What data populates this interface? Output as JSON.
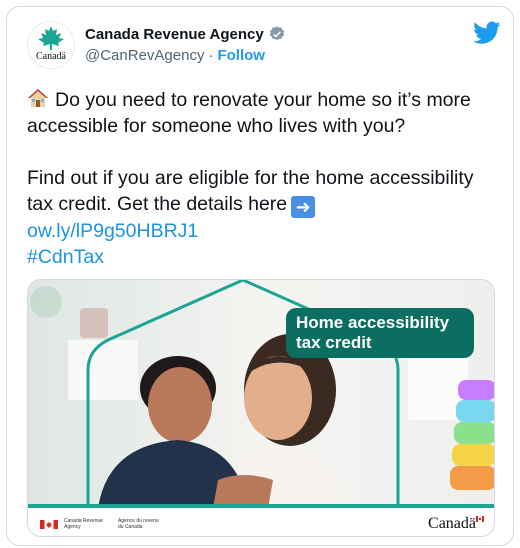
{
  "tweet": {
    "account": {
      "display_name": "Canada Revenue Agency",
      "handle": "@CanRevAgency",
      "separator": "·",
      "follow_label": "Follow",
      "avatar_wordmark": "Canadä",
      "verified": true
    },
    "text": {
      "line1": "Do you need to renovate your home so it’s more accessible for someone who lives with you?",
      "line2": "Find out if you are eligible for the home accessibility tax credit. Get the details here",
      "link": "ow.ly/lP9g50HBRJ1",
      "hashtag": "#CdnTax"
    },
    "icons": {
      "house": "house-emoji-icon",
      "arrow": "right-arrow-emoji-icon",
      "platform": "twitter-bird-icon",
      "verified": "verified-badge-icon"
    },
    "media": {
      "badge_line1": "Home accessibility",
      "badge_line2": "tax credit",
      "gov_en_line1": "Canada Revenue",
      "gov_en_line2": "Agency",
      "gov_fr_line1": "Agence du revenu",
      "gov_fr_line2": "du Canada",
      "canada_wordmark": "Canadä"
    },
    "colors": {
      "link": "#1b95e0",
      "follow": "#1d9bf0",
      "twitter_blue": "#1d9bf0",
      "badge_bg": "#0b6e61",
      "accent_teal": "#1aa594",
      "canada_red": "#d52b1e"
    }
  }
}
